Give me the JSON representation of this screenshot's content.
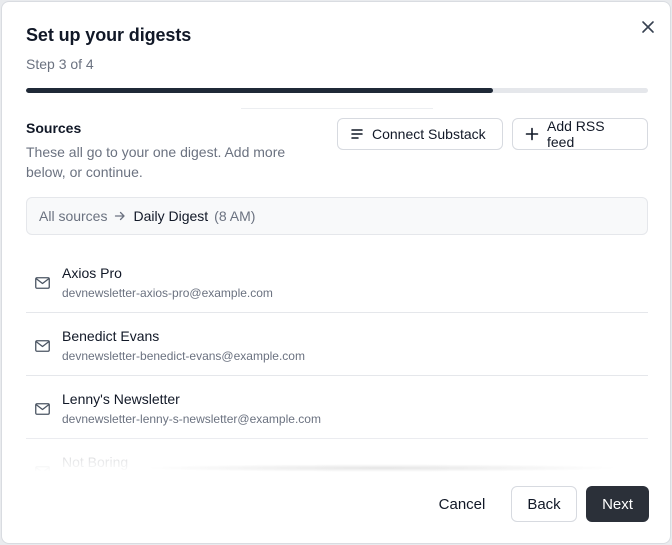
{
  "dialog": {
    "title": "Set up your digests",
    "step": "Step 3 of 4",
    "progress_fraction": 0.75,
    "close_icon": "close-icon"
  },
  "sources": {
    "label": "Sources",
    "description": "These all go to your one digest. Add more below, or continue.",
    "connect_substack": "Connect Substack",
    "add_rss": "Add RSS feed"
  },
  "breadcrumb": {
    "all": "All sources",
    "digest_name": "Daily Digest",
    "digest_time": "(8 AM)"
  },
  "items": [
    {
      "name": "Axios Pro",
      "email": "devnewsletter-axios-pro@example.com"
    },
    {
      "name": "Benedict Evans",
      "email": "devnewsletter-benedict-evans@example.com"
    },
    {
      "name": "Lenny's Newsletter",
      "email": "devnewsletter-lenny-s-newsletter@example.com"
    },
    {
      "name": "Not Boring",
      "email": ""
    }
  ],
  "footer": {
    "cancel": "Cancel",
    "back": "Back",
    "next": "Next"
  },
  "colors": {
    "primary": "#2b3039",
    "progress": "#1f2937",
    "muted_text": "#6b7280"
  }
}
